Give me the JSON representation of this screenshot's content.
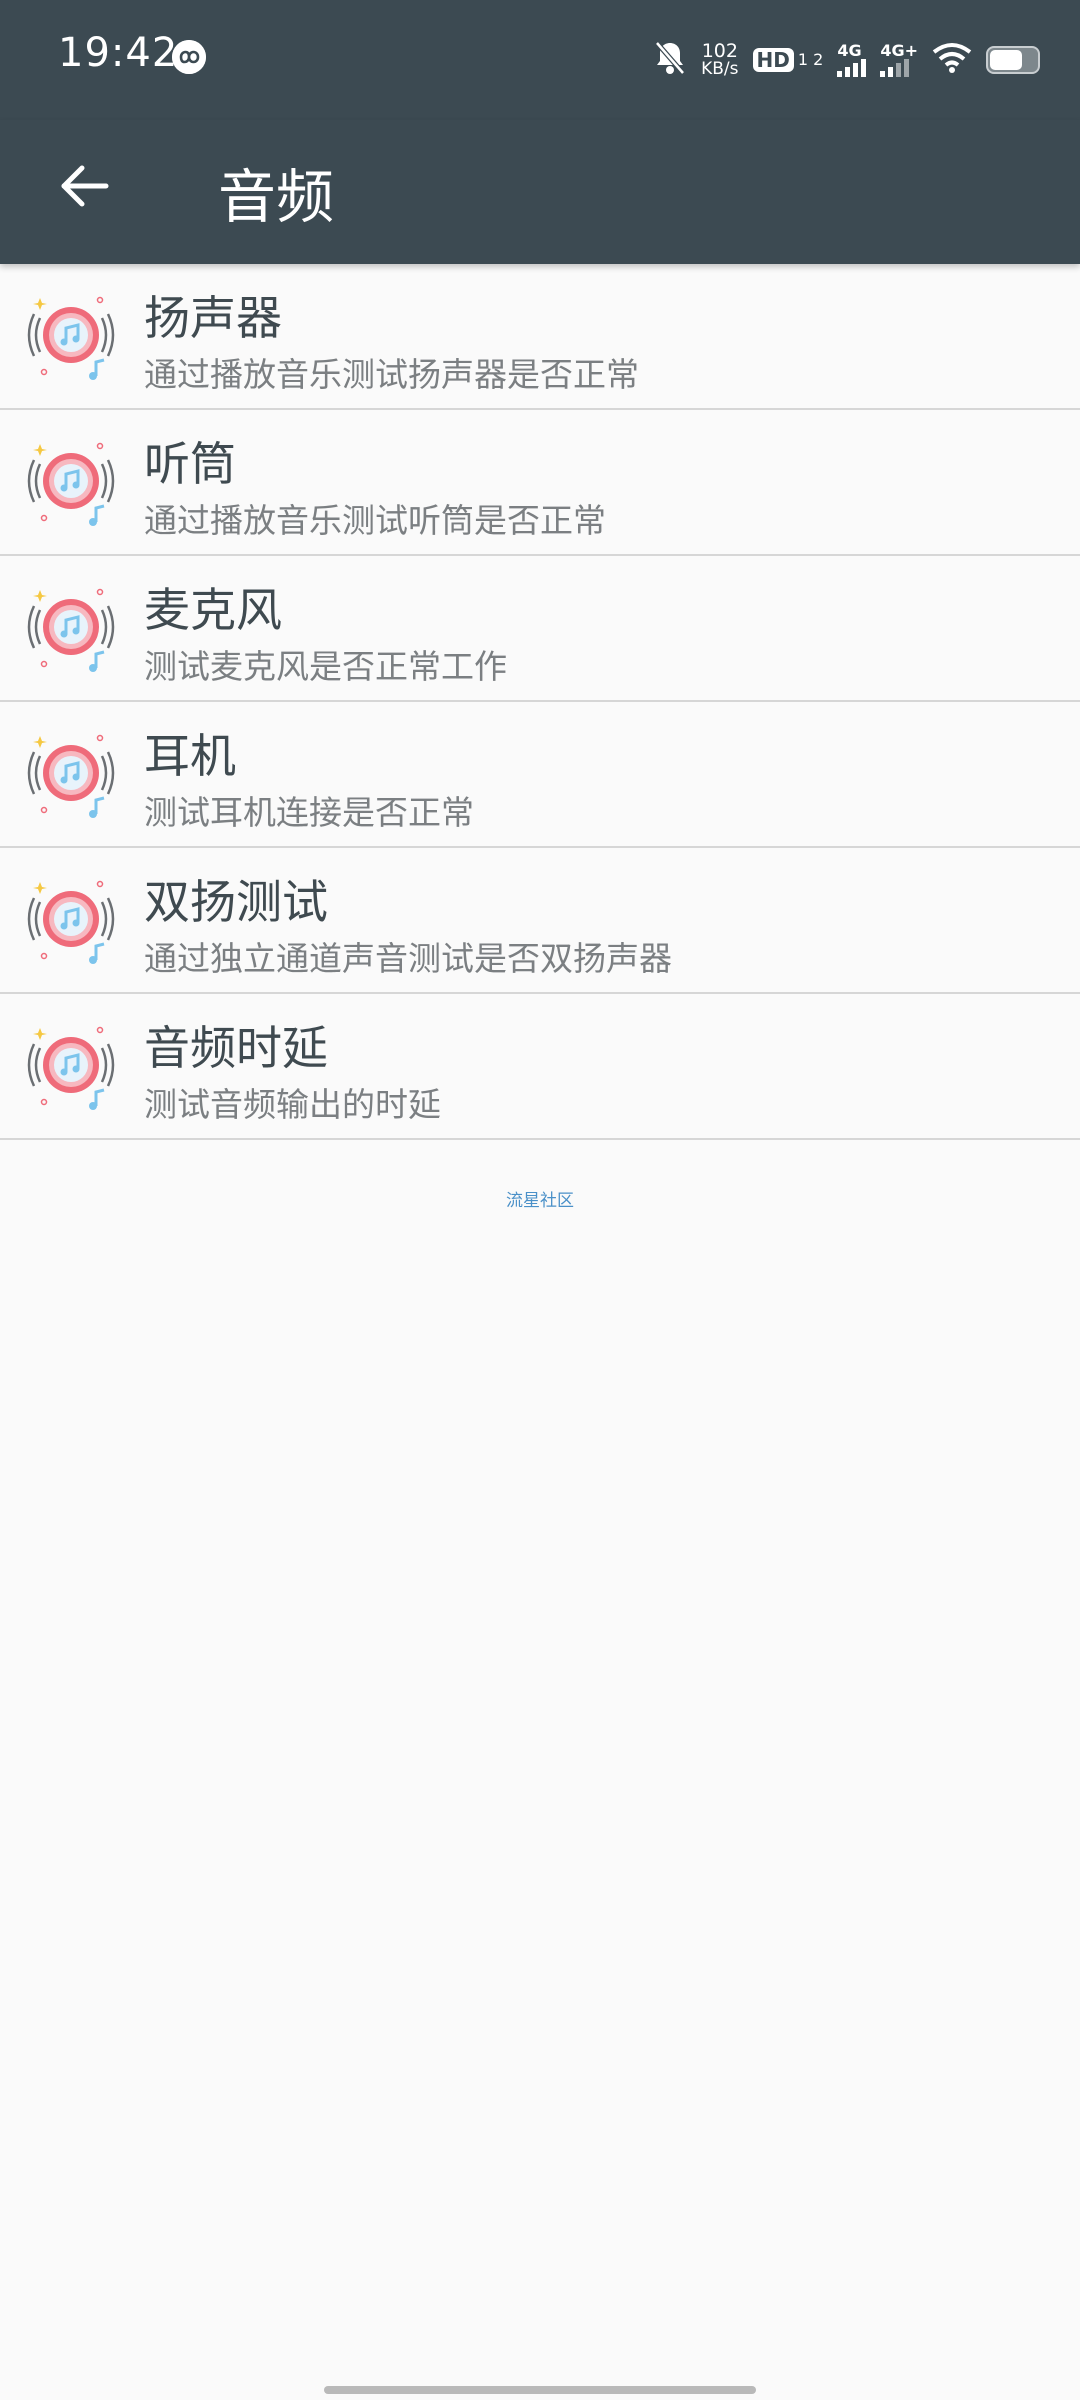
{
  "status_bar": {
    "time": "19:42",
    "net_speed_value": "102",
    "net_speed_unit": "KB/s",
    "hd_label": "HD",
    "hd_sub": "1 2",
    "sim1_label": "4G",
    "sim2_label": "4G+",
    "icons": [
      "loop-icon",
      "bell-off-icon",
      "hd-icon",
      "signal-icon",
      "wifi-icon",
      "battery-icon"
    ]
  },
  "toolbar": {
    "title": "音频",
    "back_icon": "back-arrow-icon"
  },
  "items": [
    {
      "title": "扬声器",
      "subtitle": "通过播放音乐测试扬声器是否正常"
    },
    {
      "title": "听筒",
      "subtitle": "通过播放音乐测试听筒是否正常"
    },
    {
      "title": "麦克风",
      "subtitle": "测试麦克风是否正常工作"
    },
    {
      "title": "耳机",
      "subtitle": "测试耳机连接是否正常"
    },
    {
      "title": "双扬测试",
      "subtitle": "通过独立通道声音测试是否双扬声器"
    },
    {
      "title": "音频时延",
      "subtitle": "测试音频输出的时延"
    }
  ],
  "footer": {
    "text": "流星社区"
  },
  "colors": {
    "header_bg": "#3c4a52",
    "page_bg": "#fafafa",
    "title_text": "#3f4a50",
    "subtitle_text": "#7b7f82",
    "footer_link": "#4a90c8",
    "icon_ring": "#ef6b7a",
    "icon_note": "#7cc4ec"
  }
}
